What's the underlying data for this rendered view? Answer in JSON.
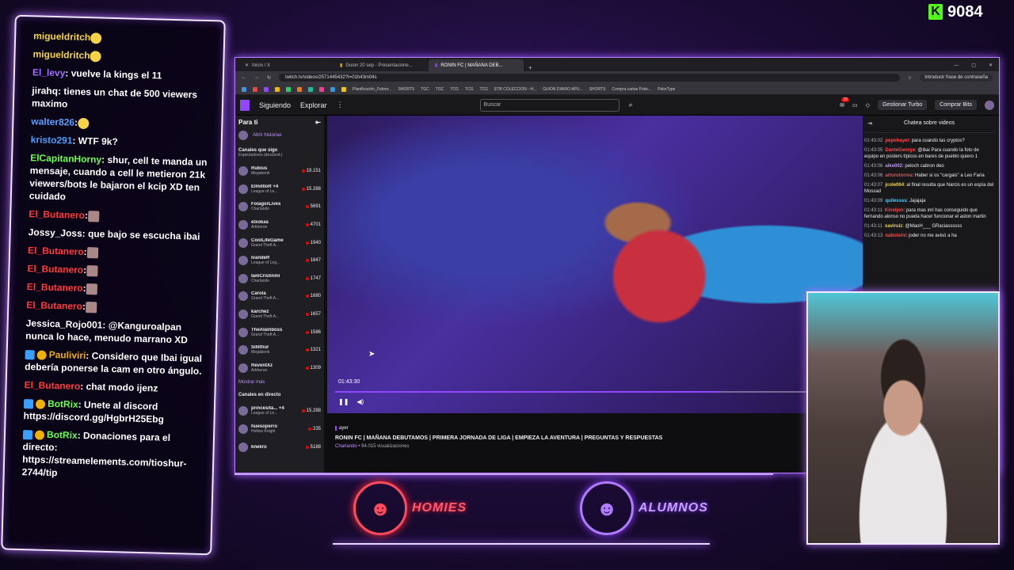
{
  "viewer_count": "9084",
  "overlay_chat": [
    {
      "user": "migueldritch",
      "color": "#f5d547",
      "text": "",
      "emote": true
    },
    {
      "user": "migueldritch",
      "color": "#f5d547",
      "text": "",
      "emote": true
    },
    {
      "user": "El_levy",
      "color": "#a070ff",
      "text": ": vuelve la kings el 11"
    },
    {
      "user": "jirahq",
      "color": "#ffffff",
      "text": ": tienes un chat de 500 viewers maximo"
    },
    {
      "user": "walter826",
      "color": "#5aa0ff",
      "text": ":",
      "emote": true
    },
    {
      "user": "kristo291",
      "color": "#4aa0ff",
      "text": ": WTF 9k?"
    },
    {
      "user": "ElCapitanHorny",
      "color": "#6aff4a",
      "text": ": shur, cell te manda un mensaje, cuando a cell le metieron 21k viewers/bots le bajaron el kcip XD ten cuidado"
    },
    {
      "user": "El_Butanero",
      "color": "#ff3a3a",
      "text": ":",
      "emote_sq": true
    },
    {
      "user": "Jossy_Joss",
      "color": "#ffffff",
      "text": ": que bajo se escucha ibai"
    },
    {
      "user": "El_Butanero",
      "color": "#ff3a3a",
      "text": ":",
      "emote_sq": true
    },
    {
      "user": "El_Butanero",
      "color": "#ff3a3a",
      "text": ":",
      "emote_sq": true
    },
    {
      "user": "El_Butanero",
      "color": "#ff3a3a",
      "text": ":",
      "emote_sq": true
    },
    {
      "user": "El_Butanero",
      "color": "#ff3a3a",
      "text": ":",
      "emote_sq": true
    },
    {
      "user": "Jessica_Rojo001",
      "color": "#ffffff",
      "text": ": @Kanguroalpan nunca lo hace, menudo marrano XD"
    },
    {
      "user": "Pauliviri",
      "color": "#f0b000",
      "text": ": Considero que Ibai igual debería ponerse la cam en otro ángulo.",
      "badges": true
    },
    {
      "user": "El_Butanero",
      "color": "#ff3a3a",
      "text": ": chat modo ijenz"
    },
    {
      "user": "BotRix",
      "color": "#6aff4a",
      "text": ": Unete al discord https://discord.gg/HgbrH25Ebg",
      "badges": true
    },
    {
      "user": "BotRix",
      "color": "#6aff4a",
      "text": ": Donaciones para el directo: https://streamelements.com/tioshur-2744/tip",
      "badges": true
    }
  ],
  "browser": {
    "tabs": [
      "Inicio / X",
      "Guion 20 sep - Presentacione...",
      "RONIN FC | MAÑANA DEB..."
    ],
    "url": "twitch.tv/videos/2571445432?t=01h43m04s",
    "password_chip": "Introducir frase de contraseña",
    "bookmarks": [
      "Planificación_Febrer...",
      "SHORTS",
      "TGC",
      "TGC",
      "TCG",
      "TCG",
      "TCG",
      "ETB COLECCION - H...",
      "GUION DIARIO APU...",
      "SHORTS",
      "Compra cartas Poke...",
      "PokeType"
    ]
  },
  "twitch": {
    "nav_following": "Siguiendo",
    "nav_explore": "Explorar",
    "search_placeholder": "Buscar",
    "turbo": "Gestionar Turbo",
    "bits": "Comprar Bits",
    "notif_count": "29"
  },
  "sidenav": {
    "title": "Para ti",
    "history": "Abrir historias",
    "followed_title": "Canales que sigo",
    "followed_sub": "Espectadores (descend.)",
    "channels": [
      {
        "name": "Rubius",
        "category": "Megabonk",
        "viewers": "19.151"
      },
      {
        "name": "ElmillloR +4",
        "category": "League of Le...",
        "viewers": "15.288"
      },
      {
        "name": "FolagorLives",
        "category": "Charlando",
        "viewers": "5691"
      },
      {
        "name": "elxokas",
        "category": "Arkheron",
        "viewers": "4701"
      },
      {
        "name": "CoolLifeGame",
        "category": "Grand Theft A...",
        "viewers": "1940"
      },
      {
        "name": "IvandeR",
        "category": "League of Leg...",
        "viewers": "1847"
      },
      {
        "name": "IamCristinini",
        "category": "Charlando",
        "viewers": "1747"
      },
      {
        "name": "Carola",
        "category": "Grand Theft A...",
        "viewers": "1680"
      },
      {
        "name": "karchez",
        "category": "Grand Theft A...",
        "viewers": "1657"
      },
      {
        "name": "TheAlainboss",
        "category": "Grand Theft A...",
        "viewers": "1586"
      },
      {
        "name": "Sillithur",
        "category": "Megabonk",
        "viewers": "1321"
      },
      {
        "name": "ReventXz",
        "category": "Arkheron",
        "viewers": "1309"
      }
    ],
    "more": "Mostrar más",
    "live_title": "Canales en directo",
    "live": [
      {
        "name": "princesita... +4",
        "category": "League of Le...",
        "viewers": "15.288"
      },
      {
        "name": "huesoperro",
        "category": "Hollow Knight",
        "viewers": "235"
      },
      {
        "name": "knekro",
        "category": "",
        "viewers": "5188"
      }
    ]
  },
  "video": {
    "timecode": "01:43:30",
    "progress": 0.74,
    "when": "ayer",
    "title": "RONIN FC | MAÑANA DEBUTAMOS | PRIMERA JORNADA DE LIGA | EMPIEZA LA AVENTURA | PREGUNTAS Y RESPUESTAS",
    "category": "Charlando",
    "views": " • 94.015 visualizaciones"
  },
  "chatpanel": {
    "title": "Chatea sobre videos",
    "messages": [
      {
        "time": "01:43:02",
        "user": "pepohayet",
        "color": "#ff4a4a",
        "text": ": para cuando las cryptos?"
      },
      {
        "time": "01:43:05",
        "user": "DanteGeorge",
        "color": "#ff4a4a",
        "text": ": @ibai Para cuando la foto de equipo en posters típicos en bares de pueblo quiero 1"
      },
      {
        "time": "01:43:06",
        "user": "aike002",
        "color": "#bf94ff",
        "text": ": peloch cabron deo"
      },
      {
        "time": "01:43:06",
        "user": "arturotorres",
        "color": "#ff4a4a",
        "text": ": Haber si os \"cargais\" a Leo Faria"
      },
      {
        "time": "01:43:07",
        "user": "jcole064",
        "color": "#f5d547",
        "text": ": al final resulta que Narcis es un espía del Mossad"
      },
      {
        "time": "01:43:09",
        "user": "quilessss",
        "color": "#4ad0ff",
        "text": ": Jajajaja"
      },
      {
        "time": "01:43:11",
        "user": "Kineljon",
        "color": "#ff4a4a",
        "text": ": para mas inri has conseguido que fernando alonso no pueda hacer funcionar el aston martin"
      },
      {
        "time": "01:43:11",
        "user": "xaviruiz",
        "color": "#f5d547",
        "text": ": @MaoH___ GRaciassssss"
      },
      {
        "time": "01:43:13",
        "user": "nabolsini",
        "color": "#ff4a4a",
        "text": ": joder no me avisó a ha"
      }
    ]
  },
  "logos": {
    "homies": "HOMIES",
    "alumnos": "ALUMNOS"
  },
  "colors": {
    "accent": "#9147ff",
    "neon": "#b070ff"
  }
}
